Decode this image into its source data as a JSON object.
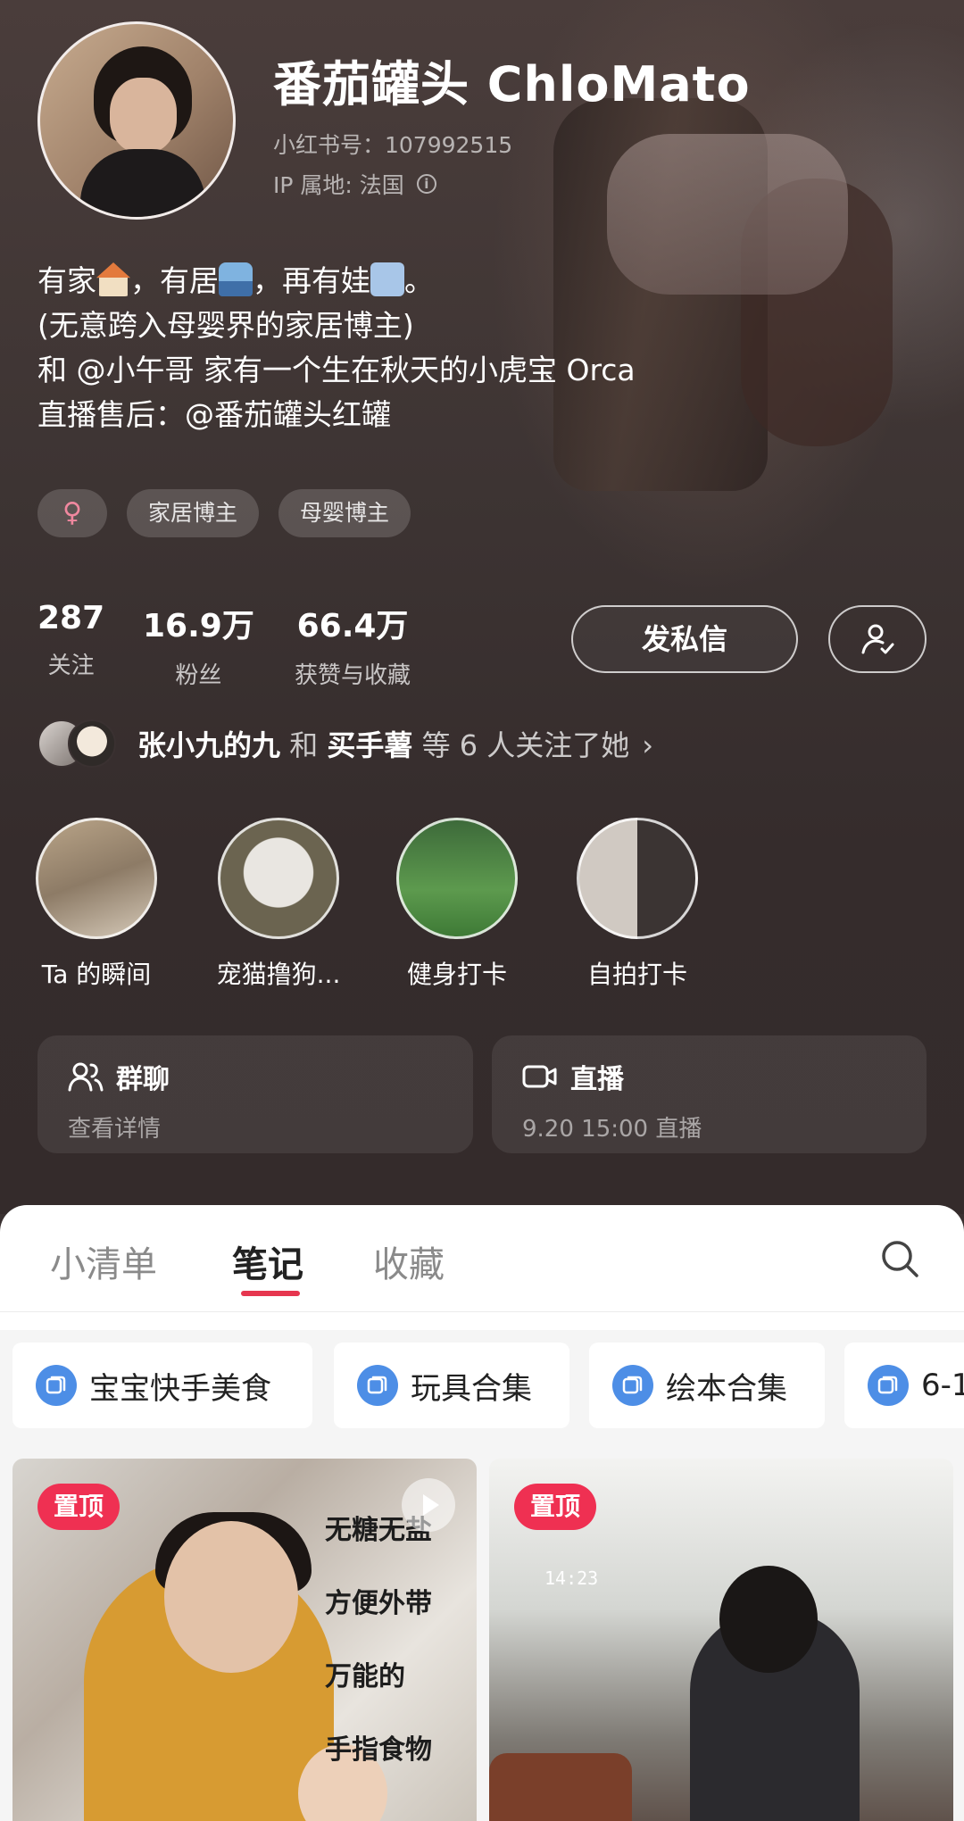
{
  "profile": {
    "nickname": "番茄罐头 ChloMato",
    "id_line": "小红书号：107992515",
    "ip_line": "IP 属地: 法国",
    "bio": {
      "line1_a": "有家",
      "line1_b": "，有居",
      "line1_c": "，再有娃",
      "line1_d": "。",
      "line2": "(无意跨入母婴界的家居博主)",
      "line3": "和 @小午哥 家有一个生在秋天的小虎宝 Orca",
      "line4": "直播售后：@番茄罐头红罐"
    },
    "tags": [
      "♀",
      "家居博主",
      "母婴博主"
    ]
  },
  "stats": [
    {
      "value": "287",
      "label": "关注"
    },
    {
      "value": "16.9万",
      "label": "粉丝"
    },
    {
      "value": "66.4万",
      "label": "获赞与收藏"
    }
  ],
  "actions": {
    "message_label": "发私信",
    "followed_icon": "user-check-icon"
  },
  "mutual": {
    "name1": "张小九的九",
    "connector": " 和 ",
    "name2": "买手薯",
    "suffix": " 等 6 人关注了她",
    "chevron": "›"
  },
  "highlights": [
    {
      "label": "Ta 的瞬间"
    },
    {
      "label": "宠猫撸狗..."
    },
    {
      "label": "健身打卡"
    },
    {
      "label": "自拍打卡"
    }
  ],
  "cards": {
    "group": {
      "title": "群聊",
      "subtitle": "查看详情",
      "icon": "group-icon"
    },
    "live": {
      "title": "直播",
      "subtitle": "9.20 15:00 直播",
      "icon": "video-camera-icon"
    }
  },
  "tabs": [
    {
      "label": "小清单",
      "active": false
    },
    {
      "label": "笔记",
      "active": true
    },
    {
      "label": "收藏",
      "active": false
    }
  ],
  "collections": [
    {
      "label": "宝宝快手美食"
    },
    {
      "label": "玩具合集"
    },
    {
      "label": "绘本合集"
    },
    {
      "label": "6-1"
    }
  ],
  "notes": [
    {
      "badge": "置顶",
      "overlay_lines": [
        "无糖无盐",
        "方便外带",
        "万能的",
        "手指食物"
      ]
    },
    {
      "badge": "置顶",
      "clock_text": "14:23"
    }
  ],
  "colors": {
    "accent": "#e6364f",
    "pin_badge": "#ef3052",
    "collection_icon": "#4d8ee6",
    "header_bg": "#3a3131"
  }
}
